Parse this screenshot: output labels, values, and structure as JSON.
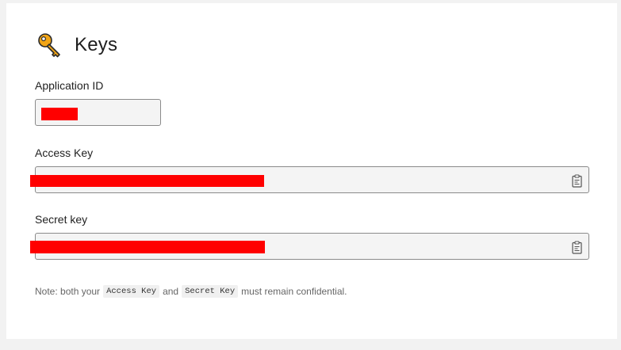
{
  "header": {
    "icon": "key-icon",
    "title": "Keys"
  },
  "fields": {
    "application_id": {
      "label": "Application ID",
      "value_redacted": true
    },
    "access_key": {
      "label": "Access Key",
      "value_redacted": true,
      "action_icon": "clipboard-copy-icon"
    },
    "secret_key": {
      "label": "Secret key",
      "value_redacted": true,
      "action_icon": "clipboard-copy-icon"
    }
  },
  "note": {
    "prefix": "Note: both your",
    "code1": "Access Key",
    "middle": "and",
    "code2": "Secret Key",
    "suffix": "must remain confidential."
  },
  "colors": {
    "redaction": "#ff0000",
    "field_bg": "#f4f4f4",
    "field_border": "#8a8a8a",
    "page_bg": "#f2f2f2",
    "card_bg": "#ffffff"
  }
}
